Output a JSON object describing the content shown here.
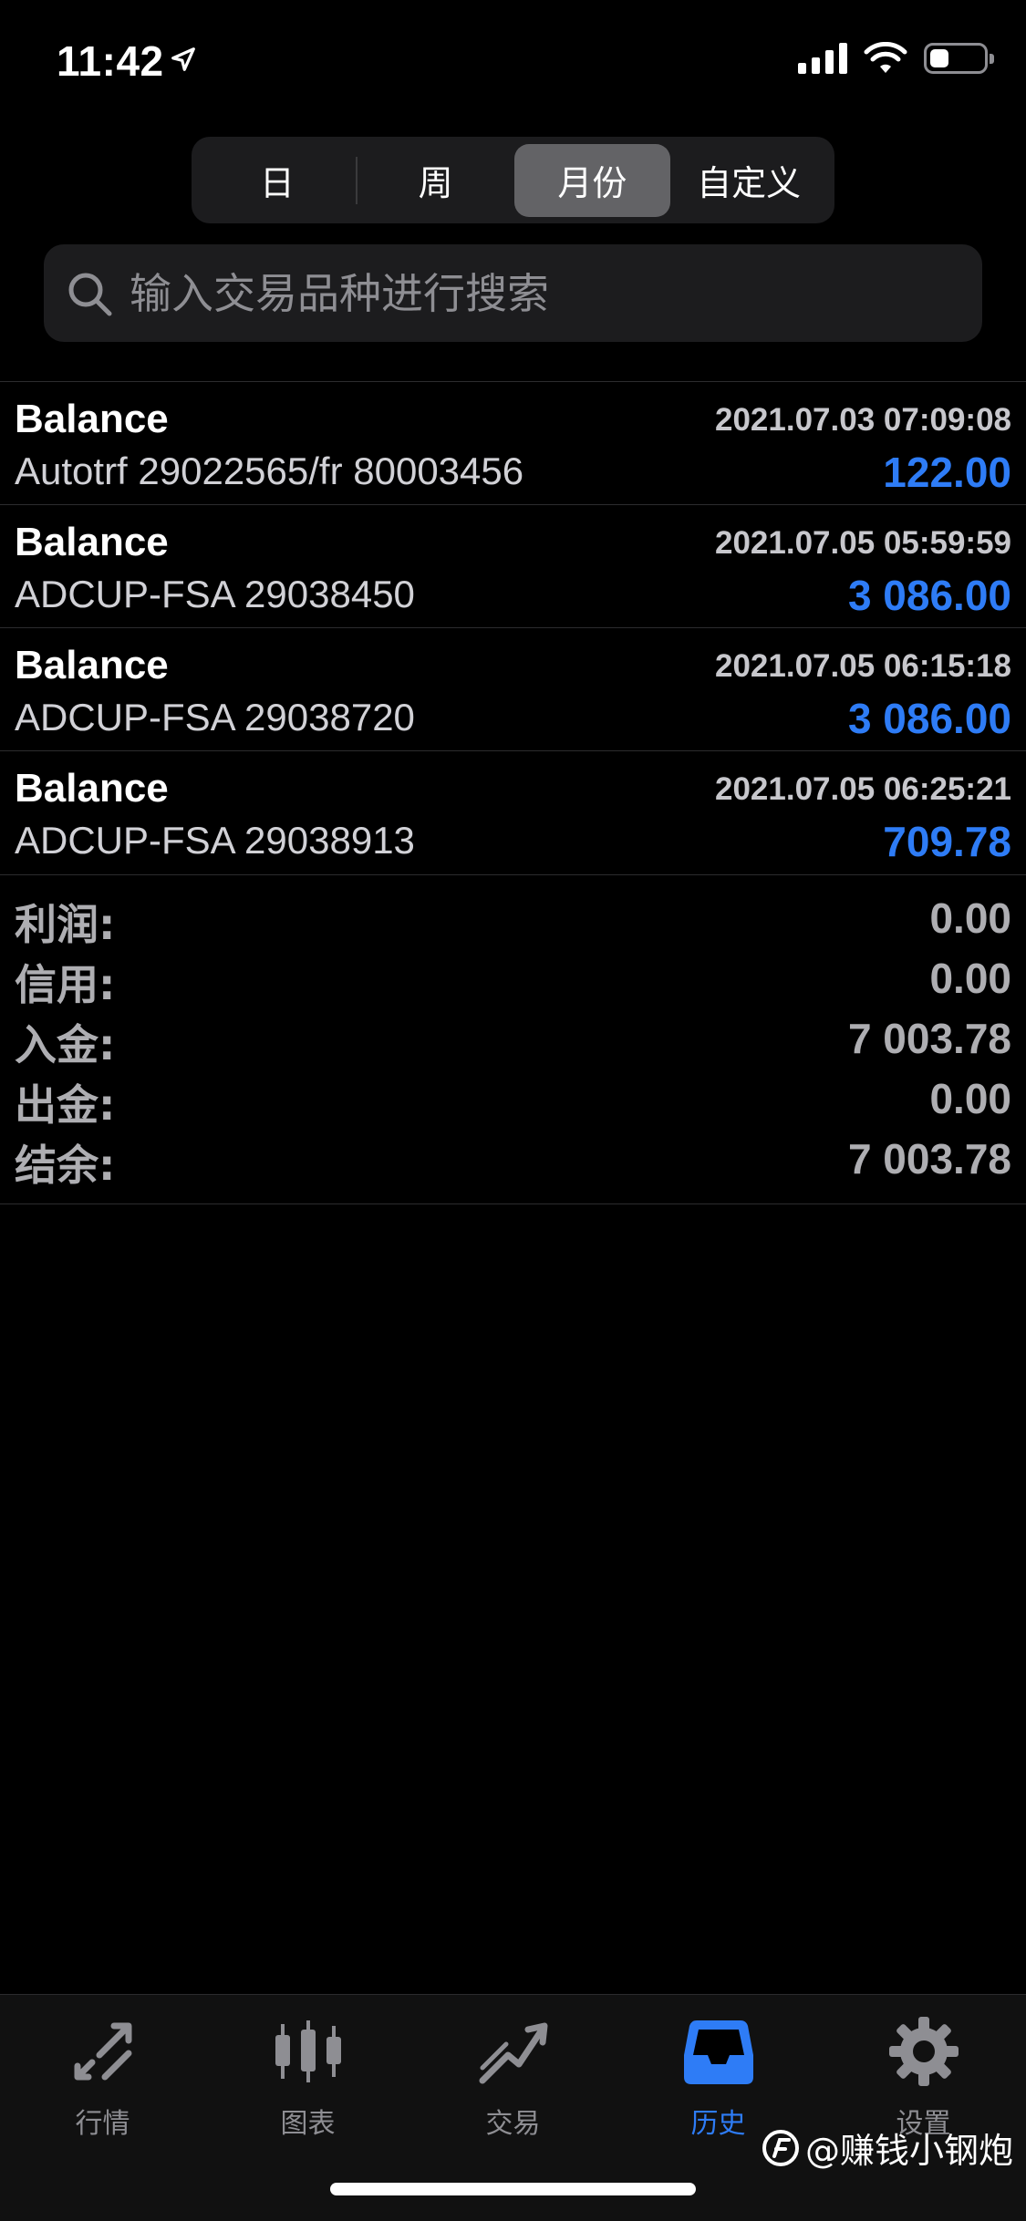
{
  "status_bar": {
    "time": "11:42",
    "battery_level": 0.35
  },
  "period_tabs": [
    {
      "label": "日",
      "active": false
    },
    {
      "label": "周",
      "active": false
    },
    {
      "label": "月份",
      "active": true
    },
    {
      "label": "自定义",
      "active": false
    }
  ],
  "search": {
    "placeholder": "输入交易品种进行搜索"
  },
  "transactions": [
    {
      "type": "Balance",
      "time": "2021.07.03 07:09:08",
      "comment": "Autotrf 29022565/fr 80003456",
      "amount": "122.00"
    },
    {
      "type": "Balance",
      "time": "2021.07.05 05:59:59",
      "comment": "ADCUP-FSA 29038450",
      "amount": "3 086.00"
    },
    {
      "type": "Balance",
      "time": "2021.07.05 06:15:18",
      "comment": "ADCUP-FSA 29038720",
      "amount": "3 086.00"
    },
    {
      "type": "Balance",
      "time": "2021.07.05 06:25:21",
      "comment": "ADCUP-FSA 29038913",
      "amount": "709.78"
    }
  ],
  "summary": [
    {
      "label": "利润:",
      "value": "0.00"
    },
    {
      "label": "信用:",
      "value": "0.00"
    },
    {
      "label": "入金:",
      "value": "7 003.78"
    },
    {
      "label": "出金:",
      "value": "0.00"
    },
    {
      "label": "结余:",
      "value": "7 003.78"
    }
  ],
  "tabbar": [
    {
      "label": "行情",
      "icon": "quotes-arrows-icon",
      "active": false
    },
    {
      "label": "图表",
      "icon": "candlestick-chart-icon",
      "active": false
    },
    {
      "label": "交易",
      "icon": "trade-trend-icon",
      "active": false
    },
    {
      "label": "历史",
      "icon": "history-inbox-icon",
      "active": true
    },
    {
      "label": "设置",
      "icon": "settings-gear-icon",
      "active": false
    }
  ],
  "watermark": {
    "text": "@赚钱小钢炮"
  },
  "colors": {
    "accent": "#2e7cf6",
    "background": "#000000",
    "panel": "#1c1c1e"
  }
}
